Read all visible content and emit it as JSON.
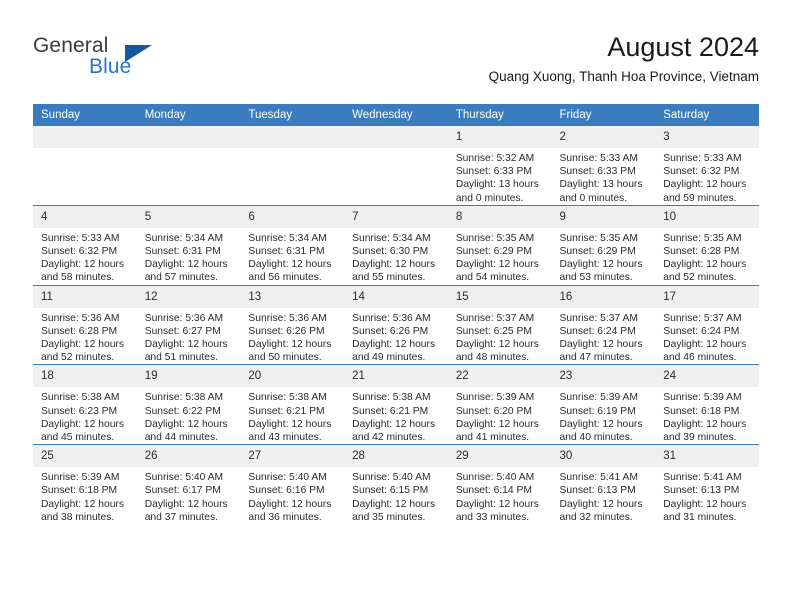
{
  "brand": {
    "name_part1": "General",
    "name_part2": "Blue",
    "logo_icon": "triangle-icon"
  },
  "header": {
    "title": "August 2024",
    "subtitle": "Quang Xuong, Thanh Hoa Province, Vietnam"
  },
  "colors": {
    "header_bar": "#3a7cbe",
    "brand_blue": "#2277c8",
    "logo_triangle": "#15599e",
    "daynum_bg": "#efefef"
  },
  "weekdays": [
    "Sunday",
    "Monday",
    "Tuesday",
    "Wednesday",
    "Thursday",
    "Friday",
    "Saturday"
  ],
  "labels": {
    "sunrise": "Sunrise:",
    "sunset": "Sunset:",
    "daylight": "Daylight:"
  },
  "weeks": [
    [
      {
        "day": "",
        "empty": true
      },
      {
        "day": "",
        "empty": true
      },
      {
        "day": "",
        "empty": true
      },
      {
        "day": "",
        "empty": true
      },
      {
        "day": "1",
        "sunrise": "Sunrise: 5:32 AM",
        "sunset": "Sunset: 6:33 PM",
        "daylight_line1": "Daylight: 13 hours",
        "daylight_line2": "and 0 minutes."
      },
      {
        "day": "2",
        "sunrise": "Sunrise: 5:33 AM",
        "sunset": "Sunset: 6:33 PM",
        "daylight_line1": "Daylight: 13 hours",
        "daylight_line2": "and 0 minutes."
      },
      {
        "day": "3",
        "sunrise": "Sunrise: 5:33 AM",
        "sunset": "Sunset: 6:32 PM",
        "daylight_line1": "Daylight: 12 hours",
        "daylight_line2": "and 59 minutes."
      }
    ],
    [
      {
        "day": "4",
        "sunrise": "Sunrise: 5:33 AM",
        "sunset": "Sunset: 6:32 PM",
        "daylight_line1": "Daylight: 12 hours",
        "daylight_line2": "and 58 minutes."
      },
      {
        "day": "5",
        "sunrise": "Sunrise: 5:34 AM",
        "sunset": "Sunset: 6:31 PM",
        "daylight_line1": "Daylight: 12 hours",
        "daylight_line2": "and 57 minutes."
      },
      {
        "day": "6",
        "sunrise": "Sunrise: 5:34 AM",
        "sunset": "Sunset: 6:31 PM",
        "daylight_line1": "Daylight: 12 hours",
        "daylight_line2": "and 56 minutes."
      },
      {
        "day": "7",
        "sunrise": "Sunrise: 5:34 AM",
        "sunset": "Sunset: 6:30 PM",
        "daylight_line1": "Daylight: 12 hours",
        "daylight_line2": "and 55 minutes."
      },
      {
        "day": "8",
        "sunrise": "Sunrise: 5:35 AM",
        "sunset": "Sunset: 6:29 PM",
        "daylight_line1": "Daylight: 12 hours",
        "daylight_line2": "and 54 minutes."
      },
      {
        "day": "9",
        "sunrise": "Sunrise: 5:35 AM",
        "sunset": "Sunset: 6:29 PM",
        "daylight_line1": "Daylight: 12 hours",
        "daylight_line2": "and 53 minutes."
      },
      {
        "day": "10",
        "sunrise": "Sunrise: 5:35 AM",
        "sunset": "Sunset: 6:28 PM",
        "daylight_line1": "Daylight: 12 hours",
        "daylight_line2": "and 52 minutes."
      }
    ],
    [
      {
        "day": "11",
        "sunrise": "Sunrise: 5:36 AM",
        "sunset": "Sunset: 6:28 PM",
        "daylight_line1": "Daylight: 12 hours",
        "daylight_line2": "and 52 minutes."
      },
      {
        "day": "12",
        "sunrise": "Sunrise: 5:36 AM",
        "sunset": "Sunset: 6:27 PM",
        "daylight_line1": "Daylight: 12 hours",
        "daylight_line2": "and 51 minutes."
      },
      {
        "day": "13",
        "sunrise": "Sunrise: 5:36 AM",
        "sunset": "Sunset: 6:26 PM",
        "daylight_line1": "Daylight: 12 hours",
        "daylight_line2": "and 50 minutes."
      },
      {
        "day": "14",
        "sunrise": "Sunrise: 5:36 AM",
        "sunset": "Sunset: 6:26 PM",
        "daylight_line1": "Daylight: 12 hours",
        "daylight_line2": "and 49 minutes."
      },
      {
        "day": "15",
        "sunrise": "Sunrise: 5:37 AM",
        "sunset": "Sunset: 6:25 PM",
        "daylight_line1": "Daylight: 12 hours",
        "daylight_line2": "and 48 minutes."
      },
      {
        "day": "16",
        "sunrise": "Sunrise: 5:37 AM",
        "sunset": "Sunset: 6:24 PM",
        "daylight_line1": "Daylight: 12 hours",
        "daylight_line2": "and 47 minutes."
      },
      {
        "day": "17",
        "sunrise": "Sunrise: 5:37 AM",
        "sunset": "Sunset: 6:24 PM",
        "daylight_line1": "Daylight: 12 hours",
        "daylight_line2": "and 46 minutes."
      }
    ],
    [
      {
        "day": "18",
        "sunrise": "Sunrise: 5:38 AM",
        "sunset": "Sunset: 6:23 PM",
        "daylight_line1": "Daylight: 12 hours",
        "daylight_line2": "and 45 minutes."
      },
      {
        "day": "19",
        "sunrise": "Sunrise: 5:38 AM",
        "sunset": "Sunset: 6:22 PM",
        "daylight_line1": "Daylight: 12 hours",
        "daylight_line2": "and 44 minutes."
      },
      {
        "day": "20",
        "sunrise": "Sunrise: 5:38 AM",
        "sunset": "Sunset: 6:21 PM",
        "daylight_line1": "Daylight: 12 hours",
        "daylight_line2": "and 43 minutes."
      },
      {
        "day": "21",
        "sunrise": "Sunrise: 5:38 AM",
        "sunset": "Sunset: 6:21 PM",
        "daylight_line1": "Daylight: 12 hours",
        "daylight_line2": "and 42 minutes."
      },
      {
        "day": "22",
        "sunrise": "Sunrise: 5:39 AM",
        "sunset": "Sunset: 6:20 PM",
        "daylight_line1": "Daylight: 12 hours",
        "daylight_line2": "and 41 minutes."
      },
      {
        "day": "23",
        "sunrise": "Sunrise: 5:39 AM",
        "sunset": "Sunset: 6:19 PM",
        "daylight_line1": "Daylight: 12 hours",
        "daylight_line2": "and 40 minutes."
      },
      {
        "day": "24",
        "sunrise": "Sunrise: 5:39 AM",
        "sunset": "Sunset: 6:18 PM",
        "daylight_line1": "Daylight: 12 hours",
        "daylight_line2": "and 39 minutes."
      }
    ],
    [
      {
        "day": "25",
        "sunrise": "Sunrise: 5:39 AM",
        "sunset": "Sunset: 6:18 PM",
        "daylight_line1": "Daylight: 12 hours",
        "daylight_line2": "and 38 minutes."
      },
      {
        "day": "26",
        "sunrise": "Sunrise: 5:40 AM",
        "sunset": "Sunset: 6:17 PM",
        "daylight_line1": "Daylight: 12 hours",
        "daylight_line2": "and 37 minutes."
      },
      {
        "day": "27",
        "sunrise": "Sunrise: 5:40 AM",
        "sunset": "Sunset: 6:16 PM",
        "daylight_line1": "Daylight: 12 hours",
        "daylight_line2": "and 36 minutes."
      },
      {
        "day": "28",
        "sunrise": "Sunrise: 5:40 AM",
        "sunset": "Sunset: 6:15 PM",
        "daylight_line1": "Daylight: 12 hours",
        "daylight_line2": "and 35 minutes."
      },
      {
        "day": "29",
        "sunrise": "Sunrise: 5:40 AM",
        "sunset": "Sunset: 6:14 PM",
        "daylight_line1": "Daylight: 12 hours",
        "daylight_line2": "and 33 minutes."
      },
      {
        "day": "30",
        "sunrise": "Sunrise: 5:41 AM",
        "sunset": "Sunset: 6:13 PM",
        "daylight_line1": "Daylight: 12 hours",
        "daylight_line2": "and 32 minutes."
      },
      {
        "day": "31",
        "sunrise": "Sunrise: 5:41 AM",
        "sunset": "Sunset: 6:13 PM",
        "daylight_line1": "Daylight: 12 hours",
        "daylight_line2": "and 31 minutes."
      }
    ]
  ]
}
